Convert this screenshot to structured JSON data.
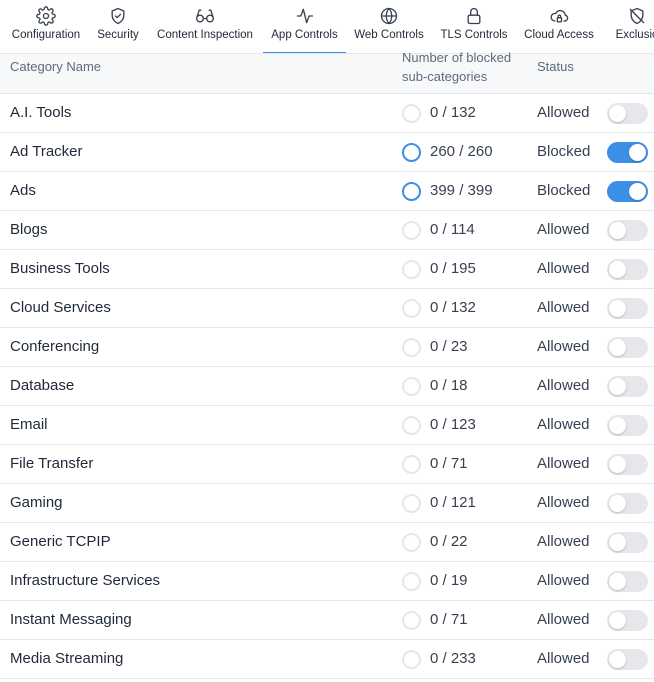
{
  "tabs": [
    {
      "label": "Configuration",
      "icon": "gear-icon"
    },
    {
      "label": "Security",
      "icon": "shield-check-icon"
    },
    {
      "label": "Content Inspection",
      "icon": "glasses-icon"
    },
    {
      "label": "App Controls",
      "icon": "activity-icon",
      "active": true
    },
    {
      "label": "Web Controls",
      "icon": "globe-icon"
    },
    {
      "label": "TLS Controls",
      "icon": "lock-icon"
    },
    {
      "label": "Cloud Access",
      "icon": "cloud-lock-icon"
    },
    {
      "label": "Exclusio",
      "icon": "shield-off-icon"
    }
  ],
  "table": {
    "headers": {
      "name": "Category Name",
      "num_line1": "Number of blocked",
      "num_line2": "sub-categories",
      "status": "Status"
    },
    "rows": [
      {
        "name": "A.I. Tools",
        "count": "0 / 132",
        "blocked_fraction": 0,
        "status": "Allowed",
        "on": false
      },
      {
        "name": "Ad Tracker",
        "count": "260 / 260",
        "blocked_fraction": 1,
        "status": "Blocked",
        "on": true
      },
      {
        "name": "Ads",
        "count": "399 / 399",
        "blocked_fraction": 1,
        "status": "Blocked",
        "on": true
      },
      {
        "name": "Blogs",
        "count": "0 / 114",
        "blocked_fraction": 0,
        "status": "Allowed",
        "on": false
      },
      {
        "name": "Business Tools",
        "count": "0 / 195",
        "blocked_fraction": 0,
        "status": "Allowed",
        "on": false
      },
      {
        "name": "Cloud Services",
        "count": "0 / 132",
        "blocked_fraction": 0,
        "status": "Allowed",
        "on": false
      },
      {
        "name": "Conferencing",
        "count": "0 / 23",
        "blocked_fraction": 0,
        "status": "Allowed",
        "on": false
      },
      {
        "name": "Database",
        "count": "0 / 18",
        "blocked_fraction": 0,
        "status": "Allowed",
        "on": false
      },
      {
        "name": "Email",
        "count": "0 / 123",
        "blocked_fraction": 0,
        "status": "Allowed",
        "on": false
      },
      {
        "name": "File Transfer",
        "count": "0 / 71",
        "blocked_fraction": 0,
        "status": "Allowed",
        "on": false
      },
      {
        "name": "Gaming",
        "count": "0 / 121",
        "blocked_fraction": 0,
        "status": "Allowed",
        "on": false
      },
      {
        "name": "Generic TCPIP",
        "count": "0 / 22",
        "blocked_fraction": 0,
        "status": "Allowed",
        "on": false
      },
      {
        "name": "Infrastructure Services",
        "count": "0 / 19",
        "blocked_fraction": 0,
        "status": "Allowed",
        "on": false
      },
      {
        "name": "Instant Messaging",
        "count": "0 / 71",
        "blocked_fraction": 0,
        "status": "Allowed",
        "on": false
      },
      {
        "name": "Media Streaming",
        "count": "0 / 233",
        "blocked_fraction": 0,
        "status": "Allowed",
        "on": false
      }
    ]
  },
  "colors": {
    "accent": "#3b8fe6",
    "toggle_off": "#e5e7eb",
    "header_bg": "#f6f8fa",
    "border": "#e5e7eb"
  }
}
